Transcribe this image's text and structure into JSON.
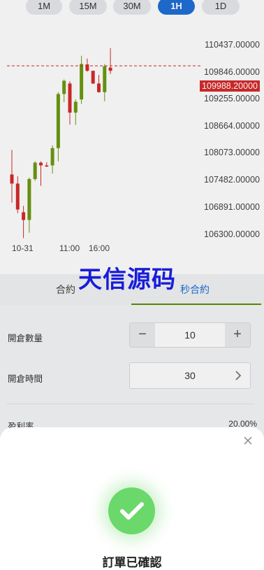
{
  "timeframes": [
    {
      "label": "1M",
      "active": false
    },
    {
      "label": "15M",
      "active": false
    },
    {
      "label": "30M",
      "active": false
    },
    {
      "label": "1H",
      "active": true
    },
    {
      "label": "1D",
      "active": false
    }
  ],
  "chart_data": {
    "type": "candlestick",
    "price_ticks": [
      "110437.00000",
      "109846.00000",
      "109255.00000",
      "108664.00000",
      "108073.00000",
      "107482.00000",
      "106891.00000",
      "106300.00000"
    ],
    "current_price": "109988.20000",
    "time_labels": [
      "10-31",
      "11:00",
      "16:00"
    ],
    "colors": {
      "up": "#6b9a10",
      "down": "#d52b2b",
      "current_line": "#d52b2b"
    },
    "candles": [
      {
        "open": 107600,
        "high": 108140,
        "low": 106980,
        "close": 107400
      },
      {
        "open": 107400,
        "high": 107560,
        "low": 106750,
        "close": 106830
      },
      {
        "open": 106770,
        "high": 106910,
        "low": 106200,
        "close": 106600
      },
      {
        "open": 106600,
        "high": 107530,
        "low": 106320,
        "close": 107500
      },
      {
        "open": 107500,
        "high": 107890,
        "low": 107460,
        "close": 107860
      },
      {
        "open": 107860,
        "high": 107890,
        "low": 107350,
        "close": 107800
      },
      {
        "open": 107800,
        "high": 107870,
        "low": 107760,
        "close": 107780
      },
      {
        "open": 107800,
        "high": 108240,
        "low": 107620,
        "close": 108180
      },
      {
        "open": 108180,
        "high": 109410,
        "low": 107890,
        "close": 109370
      },
      {
        "open": 109370,
        "high": 109690,
        "low": 109190,
        "close": 109660
      },
      {
        "open": 109600,
        "high": 109650,
        "low": 108700,
        "close": 108960
      },
      {
        "open": 108960,
        "high": 109250,
        "low": 108690,
        "close": 109200
      },
      {
        "open": 109250,
        "high": 110210,
        "low": 109150,
        "close": 110030
      },
      {
        "open": 110020,
        "high": 110150,
        "low": 109860,
        "close": 109880
      },
      {
        "open": 109880,
        "high": 109880,
        "low": 109590,
        "close": 109600
      },
      {
        "open": 109600,
        "high": 109790,
        "low": 109400,
        "close": 109410
      },
      {
        "open": 109410,
        "high": 110030,
        "low": 109210,
        "close": 109980
      },
      {
        "open": 109950,
        "high": 110380,
        "low": 109810,
        "close": 109880
      }
    ]
  },
  "watermark": "天信源码",
  "tabs": [
    {
      "label": "合約"
    },
    {
      "label": "秒合約"
    }
  ],
  "form": {
    "quantity_label": "開倉數量",
    "quantity_value": "10",
    "minus": "−",
    "plus": "+",
    "time_label": "開倉時間",
    "time_value": "30",
    "profit_label": "盈利率",
    "profit_value": "20.00%"
  },
  "modal": {
    "title": "訂單已確認",
    "close": "×"
  }
}
